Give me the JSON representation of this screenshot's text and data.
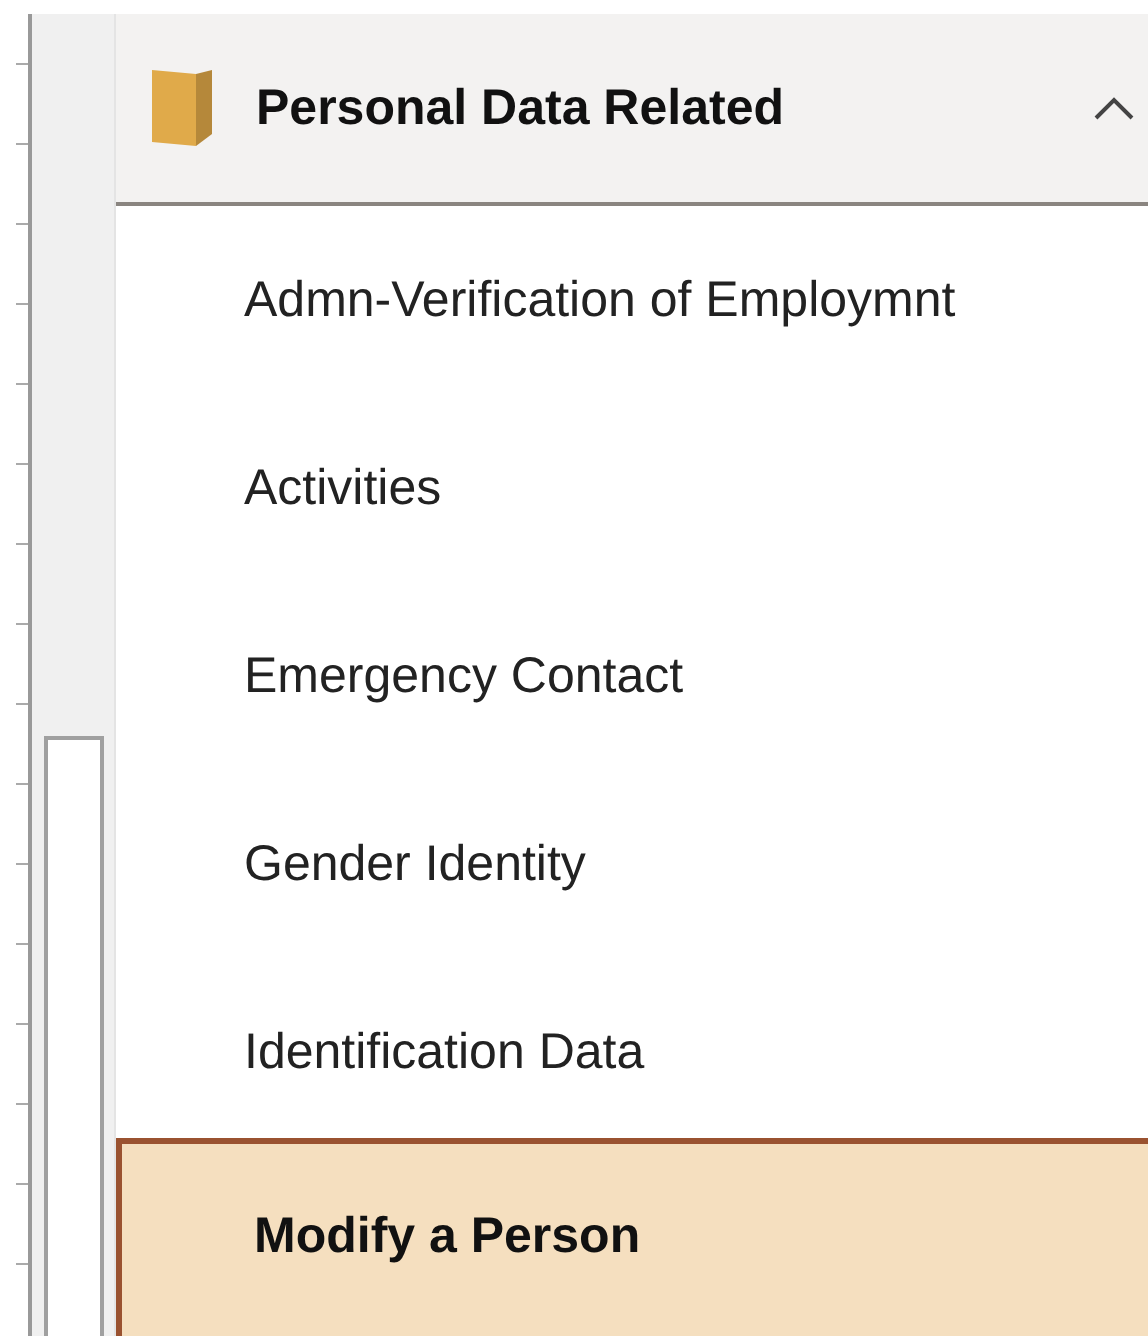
{
  "section": {
    "title": "Personal Data Related",
    "expanded": true
  },
  "items": [
    {
      "label": "Admn-Verification of Employmnt",
      "selected": false
    },
    {
      "label": "Activities",
      "selected": false
    },
    {
      "label": "Emergency Contact",
      "selected": false
    },
    {
      "label": "Gender Identity",
      "selected": false
    },
    {
      "label": "Identification Data",
      "selected": false
    },
    {
      "label": "Modify a Person",
      "selected": true
    }
  ]
}
